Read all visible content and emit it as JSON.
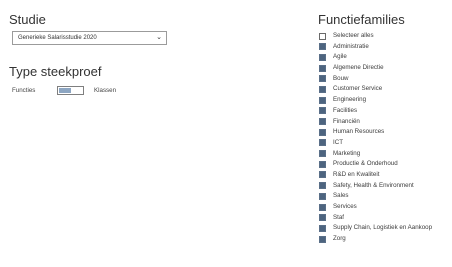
{
  "left": {
    "studie_title": "Studie",
    "study_select": {
      "value": "Generieke Salarisstudie 2020"
    },
    "type_title": "Type steekproef",
    "toggle": {
      "left_label": "Functies",
      "right_label": "Klassen",
      "state": "left"
    }
  },
  "right": {
    "title": "Functiefamilies",
    "items": [
      {
        "label": "Selecteer alles",
        "checked": false
      },
      {
        "label": "Administratie",
        "checked": true
      },
      {
        "label": "Agile",
        "checked": true
      },
      {
        "label": "Algemene Directie",
        "checked": true
      },
      {
        "label": "Bouw",
        "checked": true
      },
      {
        "label": "Customer Service",
        "checked": true
      },
      {
        "label": "Engineering",
        "checked": true
      },
      {
        "label": "Facilities",
        "checked": true
      },
      {
        "label": "Financiën",
        "checked": true
      },
      {
        "label": "Human Resources",
        "checked": true
      },
      {
        "label": "ICT",
        "checked": true
      },
      {
        "label": "Marketing",
        "checked": true
      },
      {
        "label": "Productie & Onderhoud",
        "checked": true
      },
      {
        "label": "R&D en Kwaliteit",
        "checked": true
      },
      {
        "label": "Safety, Health & Environment",
        "checked": true
      },
      {
        "label": "Sales",
        "checked": true
      },
      {
        "label": "Services",
        "checked": true
      },
      {
        "label": "Staf",
        "checked": true
      },
      {
        "label": "Supply Chain, Logistiek en Aankoop",
        "checked": true
      },
      {
        "label": "Zorg",
        "checked": true
      }
    ]
  },
  "icons": {
    "dropdown": "chevron-down-icon",
    "checkbox_checked": "checkbox-checked-icon",
    "checkbox_empty": "checkbox-empty-icon"
  },
  "colors": {
    "checkbox_fill": "#4d647f",
    "toggle_knob": "#8da6c2"
  }
}
